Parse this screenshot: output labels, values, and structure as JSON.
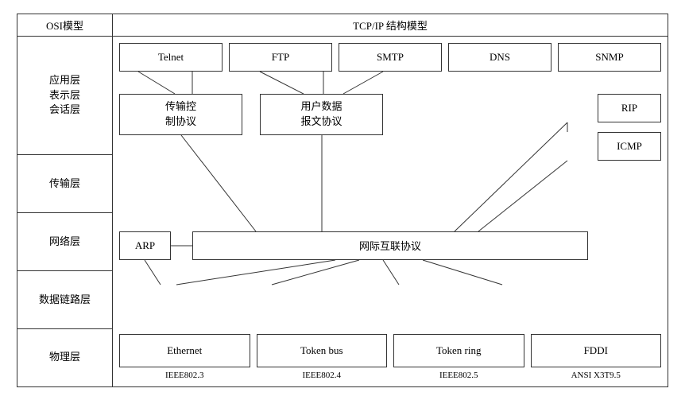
{
  "osi": {
    "title": "OSI模型",
    "layers": [
      {
        "label": "应用层\n表示层\n会话层"
      },
      {
        "label": "传输层"
      },
      {
        "label": "网络层"
      },
      {
        "label": "数据链路层"
      },
      {
        "label": "物理层"
      }
    ]
  },
  "tcpip": {
    "title": "TCP/IP 结构模型",
    "app_protocols": [
      "Telnet",
      "FTP",
      "SMTP",
      "DNS",
      "SNMP"
    ],
    "tcp_label": "传输控\n制协议",
    "udp_label": "用户数据\n报文协议",
    "rip_label": "RIP",
    "icmp_label": "ICMP",
    "arp_label": "ARP",
    "ip_label": "网际互联协议",
    "physical_boxes": [
      {
        "label": "Ethernet",
        "sublabel": "IEEE802.3"
      },
      {
        "label": "Token bus",
        "sublabel": "IEEE802.4"
      },
      {
        "label": "Token ring",
        "sublabel": "IEEE802.5"
      },
      {
        "label": "FDDI",
        "sublabel": "ANSI X3T9.5"
      }
    ]
  }
}
